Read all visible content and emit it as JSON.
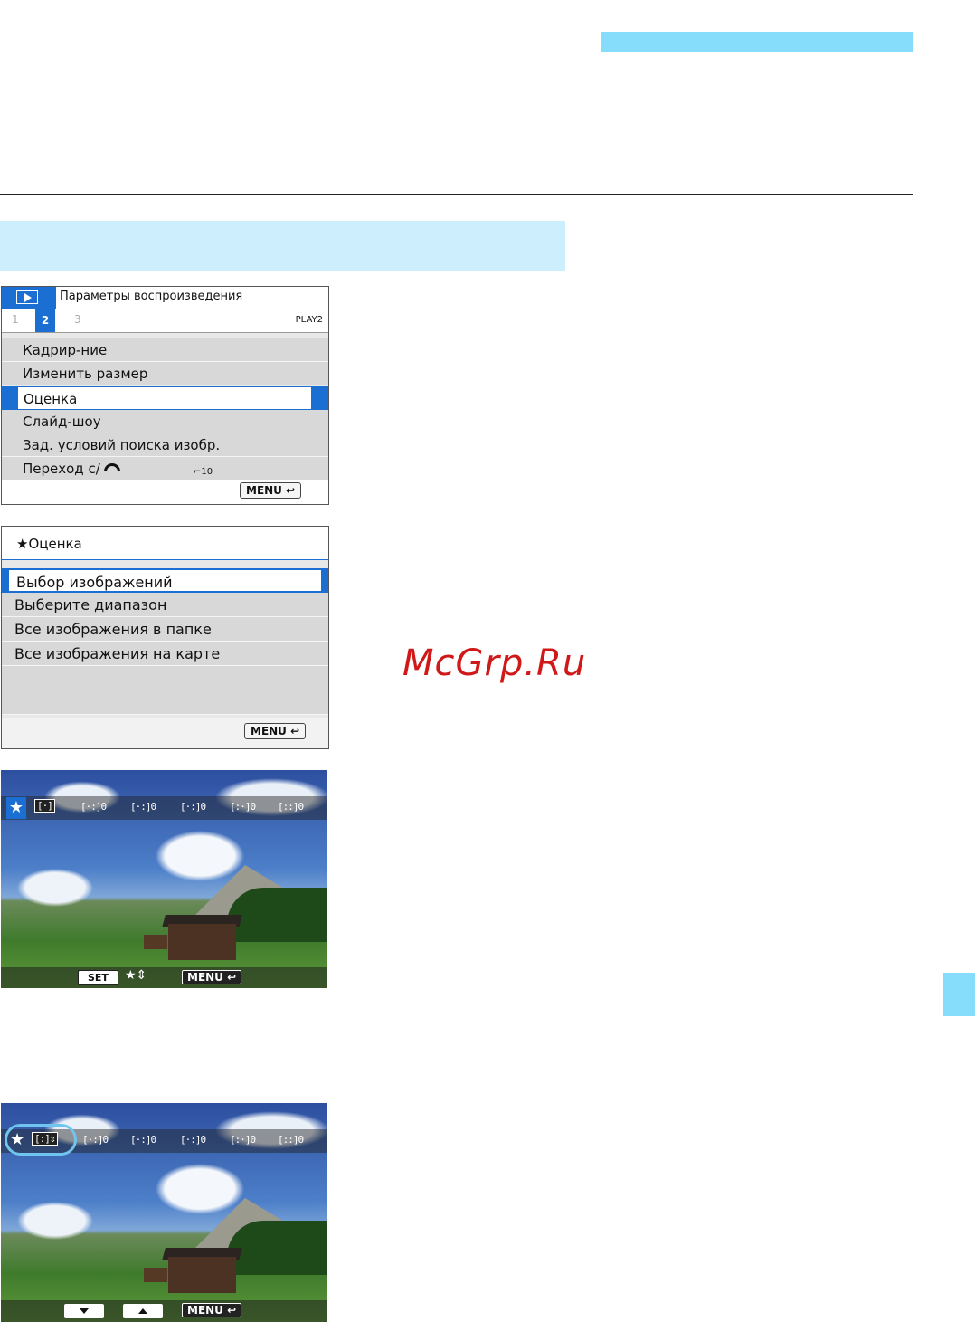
{
  "screen1": {
    "title": "Параметры воспроизведения",
    "tabs": [
      "1",
      "2",
      "3"
    ],
    "tab_right": "PLAY2",
    "items": [
      "Кадрир-ние",
      "Изменить размер",
      "Оценка",
      "Слайд-шоу",
      "Зад. условий поиска изобр.",
      "Переход с/"
    ],
    "jump_value": "10",
    "menu_label": "MENU"
  },
  "screen2": {
    "title": "★Оценка",
    "items": [
      "Выбор изображений",
      "Выберите диапазон",
      "Все изображения в папке",
      "Все изображения на карте"
    ],
    "menu_label": "MENU"
  },
  "screen3": {
    "star": "★",
    "icons": [
      "[·:]0",
      "[·:]0",
      "[·:]0",
      "[:·]0",
      "[::]0",
      "[:·]0"
    ],
    "set_label": "SET",
    "menu_label": "MENU"
  },
  "screen4": {
    "star": "★",
    "icons": [
      "[·:]0",
      "[·:]0",
      "[·:]0",
      "[:·]0",
      "[::]0",
      "[:·]1"
    ],
    "menu_label": "MENU"
  },
  "watermark": "McGrp.Ru"
}
